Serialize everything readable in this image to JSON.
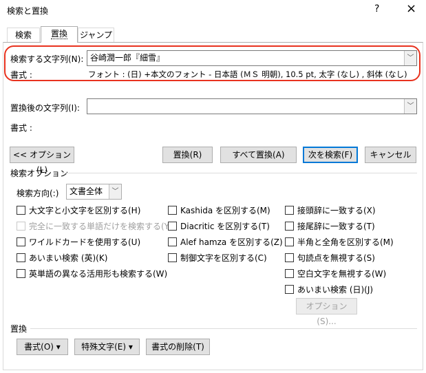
{
  "window": {
    "title": "検索と置換",
    "help": "?",
    "close": "×"
  },
  "tabs": [
    {
      "label": "検索"
    },
    {
      "label": "置換"
    },
    {
      "label": "ジャンプ"
    }
  ],
  "find": {
    "label": "検索する文字列(N):",
    "value": "谷崎潤一郎『細雪』",
    "format_label": "書式 :",
    "format_value": "フォント : (日) +本文のフォント - 日本語 (ＭＳ 明朝), 10.5 pt, 太字 (なし) , 斜体 (なし)"
  },
  "replace": {
    "label": "置換後の文字列(I):",
    "value": "",
    "format_label": "書式 :"
  },
  "buttons": {
    "options": "<< オプション(L)",
    "replace": "置換(R)",
    "replace_all": "すべて置換(A)",
    "find_next": "次を検索(F)",
    "cancel": "キャンセル"
  },
  "search_options": {
    "title": "検索オプション",
    "direction_label": "検索方向(:)",
    "direction_value": "文書全体",
    "col1": [
      {
        "label": "大文字と小文字を区別する(H)",
        "checked": false,
        "disabled": false
      },
      {
        "label": "完全に一致する単語だけを検索する(Y)",
        "checked": false,
        "disabled": true
      },
      {
        "label": "ワイルドカードを使用する(U)",
        "checked": false,
        "disabled": false
      },
      {
        "label": "あいまい検索 (英)(K)",
        "checked": false,
        "disabled": false
      },
      {
        "label": "英単語の異なる活用形も検索する(W)",
        "checked": false,
        "disabled": false
      }
    ],
    "col2": [
      {
        "label": "Kashida を区別する(M)",
        "checked": false
      },
      {
        "label": "Diacritic を区別する(T)",
        "checked": false
      },
      {
        "label": "Alef hamza を区別する(Z)",
        "checked": false
      },
      {
        "label": "制御文字を区別する(C)",
        "checked": false
      }
    ],
    "col3": [
      {
        "label": "接頭辞に一致する(X)",
        "checked": false
      },
      {
        "label": "接尾辞に一致する(T)",
        "checked": false
      },
      {
        "label": "半角と全角を区別する(M)",
        "checked": false
      },
      {
        "label": "句読点を無視する(S)",
        "checked": false
      },
      {
        "label": "空白文字を無視する(W)",
        "checked": false
      },
      {
        "label": "あいまい検索 (日)(J)",
        "checked": false
      }
    ],
    "fuzzy_options_button": "オプション(S)..."
  },
  "replace_section": {
    "title": "置換",
    "format_button": "書式(O) ▾",
    "special_button": "特殊文字(E) ▾",
    "clear_format_button": "書式の削除(T)"
  },
  "colors": {
    "highlight": "#e8321e",
    "focus": "#0078d7"
  }
}
